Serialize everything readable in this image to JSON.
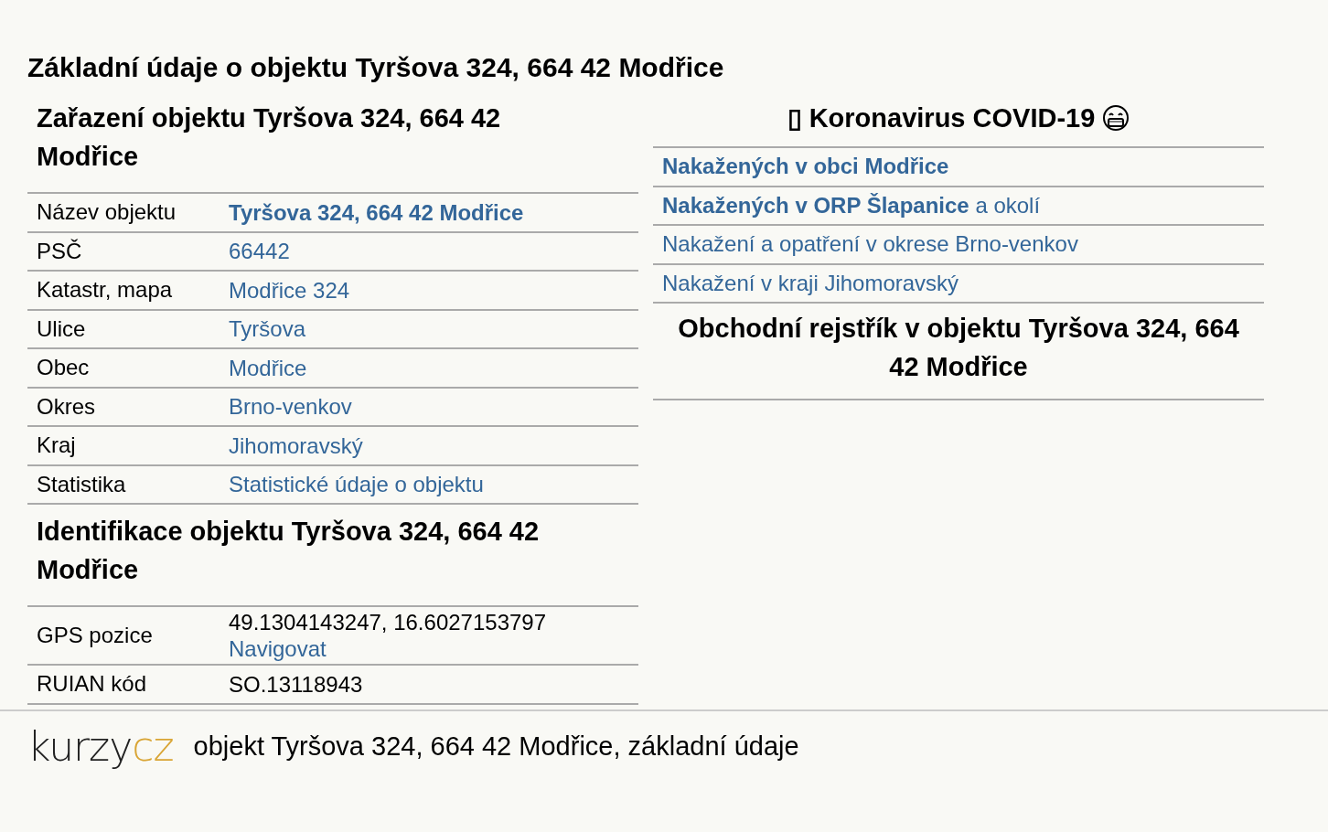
{
  "title": "Základní údaje o objektu Tyršova 324, 664 42 Modřice",
  "classification": {
    "heading": "Zařazení objektu Tyršova 324, 664 42 Modřice",
    "rows": [
      {
        "label": "Název objektu",
        "value": "Tyršova 324, 664 42 Modřice",
        "kind": "bold-link"
      },
      {
        "label": "PSČ",
        "value": "66442",
        "kind": "link"
      },
      {
        "label": "Katastr, mapa",
        "value": "Modřice 324",
        "kind": "link"
      },
      {
        "label": "Ulice",
        "value": "Tyršova",
        "kind": "link"
      },
      {
        "label": "Obec",
        "value": "Modřice",
        "kind": "link"
      },
      {
        "label": "Okres",
        "value": "Brno-venkov",
        "kind": "link"
      },
      {
        "label": "Kraj",
        "value": "Jihomoravský",
        "kind": "link"
      },
      {
        "label": "Statistika",
        "value": "Statistické údaje o objektu",
        "kind": "link"
      }
    ]
  },
  "identification": {
    "heading": "Identifikace objektu Tyršova 324, 664 42 Modřice",
    "rows": [
      {
        "label": "GPS pozice",
        "value": "49.1304143247, 16.6027153797",
        "link": "Navigovat",
        "kind": "text-link"
      },
      {
        "label": "RUIAN kód",
        "value": "SO.13118943",
        "kind": "text"
      }
    ]
  },
  "covid": {
    "symbol": "▯",
    "heading": "Koronavirus COVID-19",
    "links": [
      "**Nakažených v obci Modřice**",
      "**Nakažených v ORP Šlapanice** a okolí",
      "Nakažení a opatření v okrese Brno-venkov",
      "Nakažení v kraji Jihomoravský"
    ]
  },
  "register": {
    "heading": "Obchodní rejstřík v objektu Tyršova 324, 664 42 Modřice"
  },
  "footer": {
    "logo_left": "kurzy",
    "logo_right": "cz",
    "text": "objekt Tyršova 324, 664 42 Modřice, základní údaje"
  }
}
